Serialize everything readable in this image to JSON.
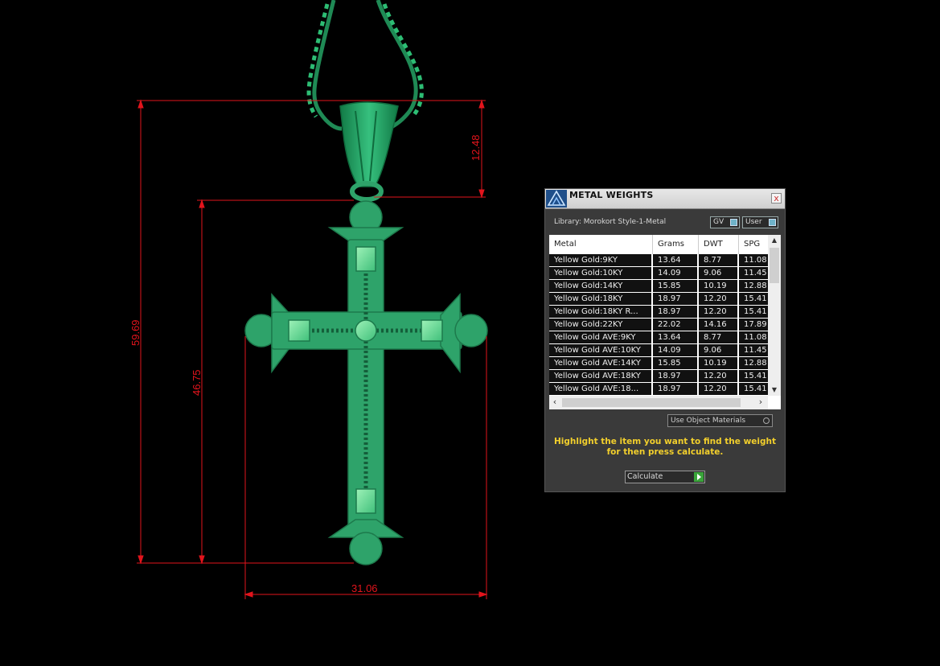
{
  "dimensions": {
    "top": "12.48",
    "height_full": "59.69",
    "height_cross": "46.75",
    "width": "31.06"
  },
  "panel": {
    "title": "METAL WEIGHTS",
    "close": "x",
    "library": "Library: Morokort Style-1-Metal",
    "gv": "GV",
    "user": "User",
    "columns": [
      "Metal",
      "Grams",
      "DWT",
      "SPG"
    ],
    "rows": [
      [
        "Yellow Gold:9KY",
        "13.64",
        "8.77",
        "11.08"
      ],
      [
        "Yellow Gold:10KY",
        "14.09",
        "9.06",
        "11.45"
      ],
      [
        "Yellow Gold:14KY",
        "15.85",
        "10.19",
        "12.88"
      ],
      [
        "Yellow Gold:18KY",
        "18.97",
        "12.20",
        "15.41"
      ],
      [
        "Yellow Gold:18KY R...",
        "18.97",
        "12.20",
        "15.41"
      ],
      [
        "Yellow Gold:22KY",
        "22.02",
        "14.16",
        "17.89"
      ],
      [
        "Yellow Gold AVE:9KY",
        "13.64",
        "8.77",
        "11.08"
      ],
      [
        "Yellow Gold AVE:10KY",
        "14.09",
        "9.06",
        "11.45"
      ],
      [
        "Yellow Gold AVE:14KY",
        "15.85",
        "10.19",
        "12.88"
      ],
      [
        "Yellow Gold AVE:18KY",
        "18.97",
        "12.20",
        "15.41"
      ],
      [
        "Yellow Gold AVE:18...",
        "18.97",
        "12.20",
        "15.41"
      ]
    ],
    "use_materials": "Use Object Materials",
    "message_line1": "Highlight the item you want to find the weight",
    "message_line2": "for then press calculate.",
    "calculate": "Calculate"
  },
  "colors": {
    "dimension": "#e2141c",
    "model": "#2ea36a",
    "message": "#f2cf2c"
  }
}
